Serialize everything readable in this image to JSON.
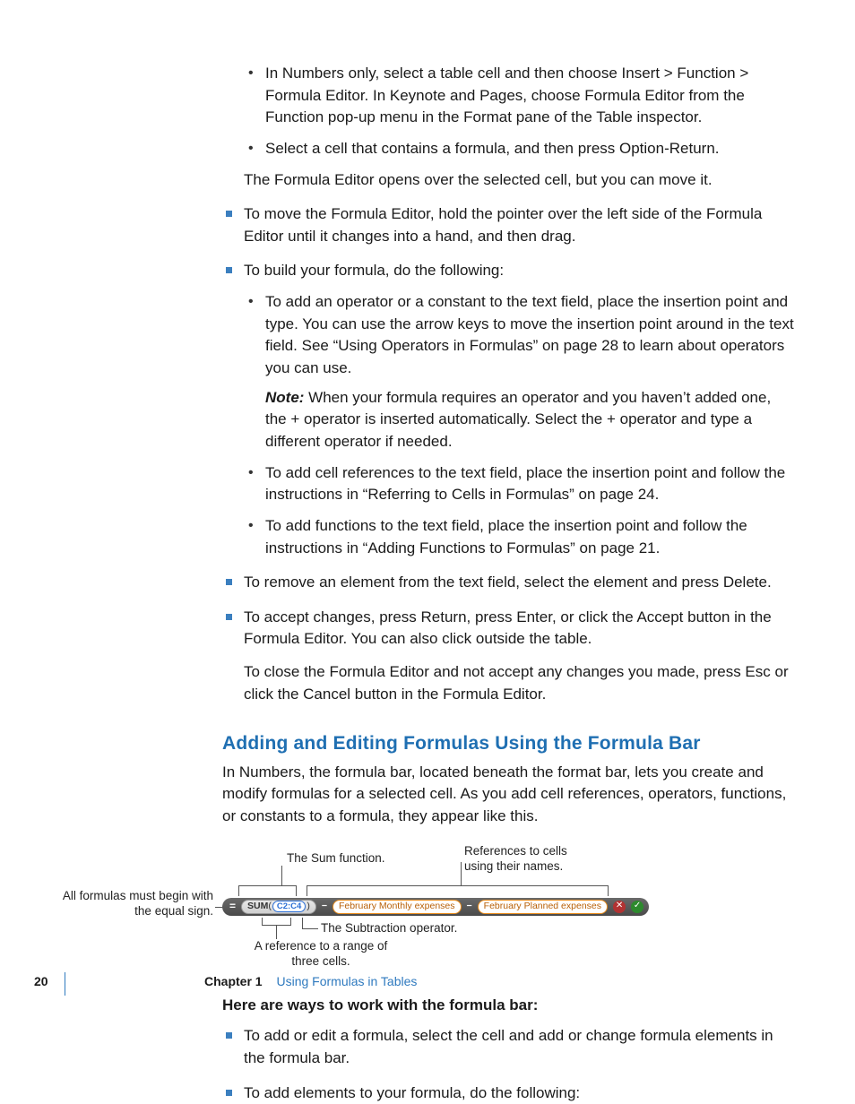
{
  "list1": {
    "sub1": "In Numbers only, select a table cell and then choose Insert > Function > Formula Editor. In Keynote and Pages, choose Formula Editor from the Function pop-up menu in the Format pane of the Table inspector.",
    "sub2": "Select a cell that contains a formula, and then press Option-Return.",
    "after": "The Formula Editor opens over the selected cell, but you can move it."
  },
  "items": {
    "move": "To move the Formula Editor, hold the pointer over the left side of the Formula Editor until it changes into a hand, and then drag.",
    "build": "To build your formula, do the following:",
    "build_sub1": "To add an operator or a constant to the text field, place the insertion point and type. You can use the arrow keys to move the insertion point around in the text field. See “Using Operators in Formulas” on page 28 to learn about operators you can use.",
    "note_label": "Note:",
    "note_body": "  When your formula requires an operator and you haven’t added one, the + operator is inserted automatically. Select the + operator and type a different operator if needed.",
    "build_sub2": "To add cell references to the text field, place the insertion point and follow the instructions in “Referring to Cells in Formulas” on page 24.",
    "build_sub3": "To add functions to the text field, place the insertion point and follow the instructions in “Adding Functions to Formulas” on page 21.",
    "remove": "To remove an element from the text field, select the element and press Delete.",
    "accept": "To accept changes, press Return, press Enter, or click the Accept button in the Formula Editor. You can also click outside the table.",
    "close": "To close the Formula Editor and not accept any changes you made, press Esc or click the Cancel button in the Formula Editor."
  },
  "section": {
    "heading": "Adding and Editing Formulas Using the Formula Bar",
    "intro": "In Numbers, the formula bar, located beneath the format bar, lets you create and modify formulas for a selected cell. As you add cell references, operators, functions, or constants to a formula, they appear like this."
  },
  "diagram": {
    "callout_left": "All formulas must begin with the equal sign.",
    "callout_sum": "The Sum function.",
    "callout_refs": "References to cells using their names.",
    "callout_minus": "The Subtraction operator.",
    "callout_range": "A reference to a range of three cells.",
    "eq": "=",
    "sum": "SUM",
    "range": "C2:C4",
    "minus": "−",
    "ref1": "February Monthly expenses",
    "ref2": "February Planned expenses",
    "cancel": "✕",
    "accept": "✓"
  },
  "ways": {
    "heading": "Here are ways to work with the formula bar:",
    "item1": "To add or edit a formula, select the cell and add or change formula elements in the formula bar.",
    "item2": "To add elements to your formula, do the following:"
  },
  "footer": {
    "page": "20",
    "chapter_label": "Chapter 1",
    "chapter_title": "Using Formulas in Tables"
  }
}
